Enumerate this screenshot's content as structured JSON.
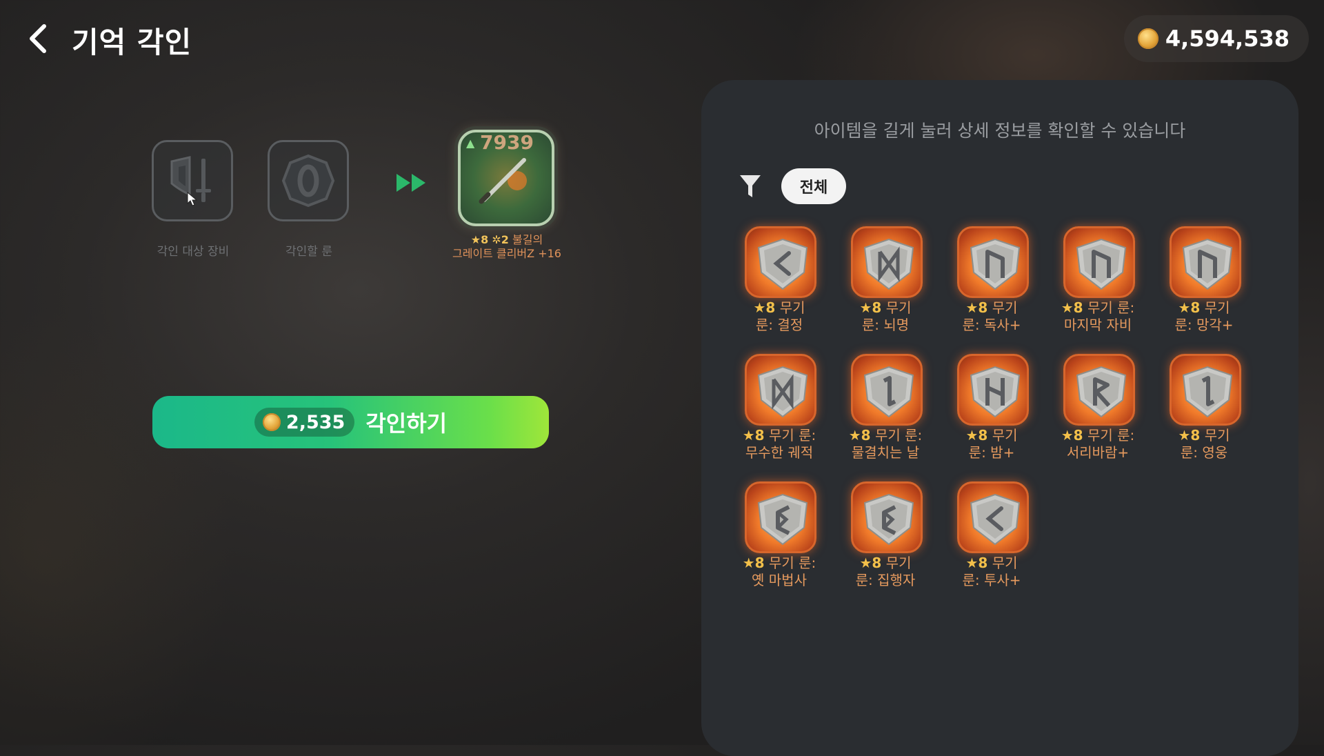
{
  "header": {
    "title": "기억 각인",
    "currency_amount": "4,594,538"
  },
  "left": {
    "slot_equipment_label": "각인 대상 장비",
    "slot_rune_label": "각인할 룬",
    "result": {
      "power": "7939",
      "star": "★8",
      "enhance": "✲2",
      "name_line1": "불길의",
      "name_line2": "그레이트 클리버Z +16"
    },
    "engrave_cost": "2,535",
    "engrave_label": "각인하기"
  },
  "panel": {
    "hint": "아이템을 길게 눌러 상세 정보를 확인할 수 있습니다",
    "filter_label": "전체",
    "runes": [
      {
        "star": "★8",
        "line1": " 무기",
        "line2": "룬: 결정",
        "glyph": "kaunan"
      },
      {
        "star": "★8",
        "line1": " 무기",
        "line2": "룬: 뇌명",
        "glyph": "dagaz"
      },
      {
        "star": "★8",
        "line1": " 무기",
        "line2": "룬: 독사+",
        "glyph": "uruz"
      },
      {
        "star": "★8",
        "line1": " 무기 룬:",
        "line2": "마지막 자비",
        "glyph": "uruz"
      },
      {
        "star": "★8",
        "line1": " 무기",
        "line2": "룬: 망각+",
        "glyph": "uruz"
      },
      {
        "star": "★8",
        "line1": " 무기 룬:",
        "line2": "무수한 궤적",
        "glyph": "dagaz"
      },
      {
        "star": "★8",
        "line1": " 무기 룬:",
        "line2": "물결치는 날",
        "glyph": "eihwaz"
      },
      {
        "star": "★8",
        "line1": " 무기",
        "line2": "룬: 밤+",
        "glyph": "hagalaz"
      },
      {
        "star": "★8",
        "line1": " 무기 룬:",
        "line2": "서리바람+",
        "glyph": "raido"
      },
      {
        "star": "★8",
        "line1": " 무기",
        "line2": "룬: 영웅",
        "glyph": "eihwaz"
      },
      {
        "star": "★8",
        "line1": " 무기 룬:",
        "line2": "옛 마법사",
        "glyph": "perthro"
      },
      {
        "star": "★8",
        "line1": " 무기",
        "line2": "룬: 집행자",
        "glyph": "perthro"
      },
      {
        "star": "★8",
        "line1": " 무기",
        "line2": "룬: 투사+",
        "glyph": "kaunan"
      }
    ]
  },
  "colors": {
    "accent_green_start": "#1bb889",
    "accent_green_end": "#9fe63a",
    "rune_orange": "#f07a2a",
    "panel_bg": "#2a2d31"
  },
  "icons": [
    "back-icon",
    "coin-icon",
    "shield-sword-icon",
    "rune-slot-icon",
    "fast-forward-icon",
    "filter-icon",
    "rune-stone-icon"
  ]
}
